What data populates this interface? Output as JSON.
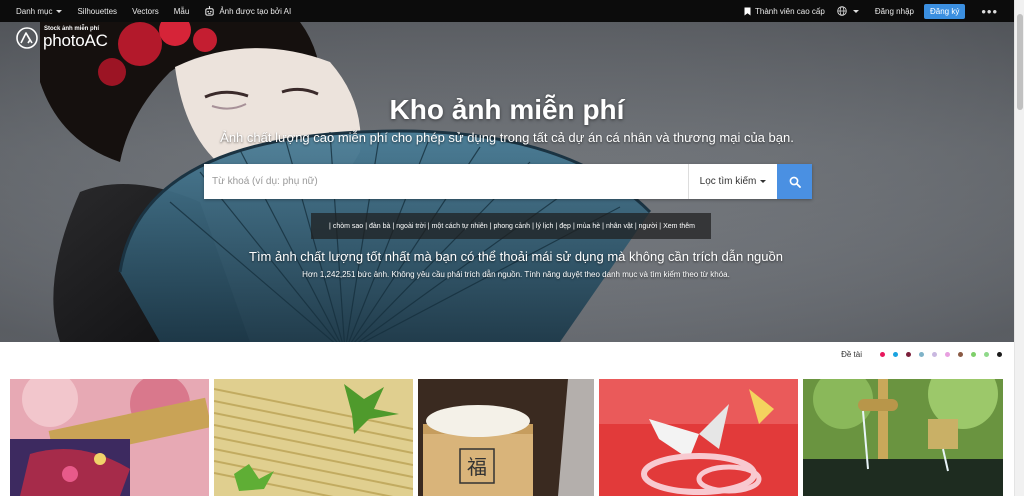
{
  "topbar": {
    "categories_label": "Danh mục",
    "silhouettes_label": "Silhouettes",
    "vectors_label": "Vectors",
    "templates_label": "Mẫu",
    "ai_label": "Ảnh được tạo bởi AI",
    "premium_label": "Thành viên cao cấp",
    "login_label": "Đăng nhập",
    "signup_label": "Đăng ký",
    "more_label": "•••"
  },
  "logo": {
    "tagline": "Stock ảnh miễn phí",
    "name": "photoAC"
  },
  "hero": {
    "title": "Kho ảnh miễn phí",
    "subtitle": "Ảnh chất lượng cao miễn phí cho phép sử dụng trong tất cả dự án cá nhân và thương mại của bạn.",
    "tagline": "Tìm ảnh chất lượng tốt nhất mà bạn có thể thoải mái sử dụng mà không cần trích dẫn nguồn",
    "info": "Hơn 1,242,251 bức ảnh. Không yêu cầu phải trích dẫn nguồn. Tính năng duyệt theo danh mục và tìm kiếm theo từ khóa."
  },
  "search": {
    "placeholder": "Từ khoá (ví dụ: phụ nữ)",
    "value": "",
    "filter_label": "Lọc tìm kiếm"
  },
  "keywords": [
    "chòm sao",
    "đàn bà",
    "ngoài trời",
    "một cách tự nhiên",
    "phong cảnh",
    "lý lịch",
    "đẹp",
    "mùa hè",
    "nhân vật",
    "người",
    "Xem thêm"
  ],
  "themes": {
    "label": "Đề tài",
    "colors": [
      "#e8175d",
      "#1aa3e0",
      "#7b1f3a",
      "#7fb3c8",
      "#c9b8e0",
      "#e8a0e0",
      "#8a5a44",
      "#7ecf6a",
      "#8fd98a",
      "#1a1a1a"
    ]
  },
  "accent_color": "#4a90e2"
}
